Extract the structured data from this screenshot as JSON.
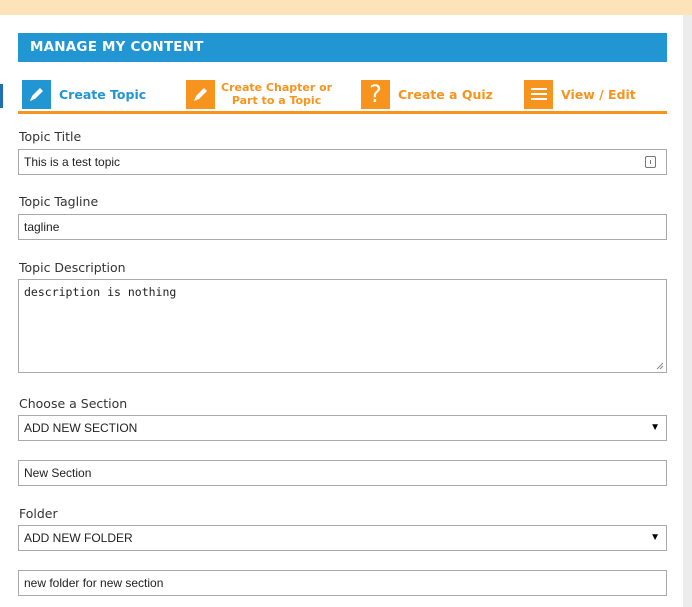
{
  "header": {
    "title": "MANAGE MY CONTENT"
  },
  "tabs": [
    {
      "label": "Create Topic",
      "icon": "pencil-icon",
      "active": true
    },
    {
      "label_line1": "Create Chapter or",
      "label_line2": "Part to a Topic",
      "icon": "pencil-icon"
    },
    {
      "label": "Create a Quiz",
      "icon": "question-icon"
    },
    {
      "label": "View / Edit",
      "icon": "list-icon"
    }
  ],
  "form": {
    "topic_title": {
      "label": "Topic Title",
      "value": "This is a test topic"
    },
    "topic_tagline": {
      "label": "Topic Tagline",
      "value": "tagline"
    },
    "topic_description": {
      "label": "Topic Description",
      "value": "description is nothing"
    },
    "section": {
      "label": "Choose a Section",
      "selected": "ADD NEW SECTION",
      "new_value": "New Section"
    },
    "folder": {
      "label": "Folder",
      "selected": "ADD NEW FOLDER",
      "new_value": "new folder for new section"
    }
  },
  "colors": {
    "primary": "#2196d3",
    "accent": "#f7941d",
    "top_strip": "#fde3b8"
  }
}
